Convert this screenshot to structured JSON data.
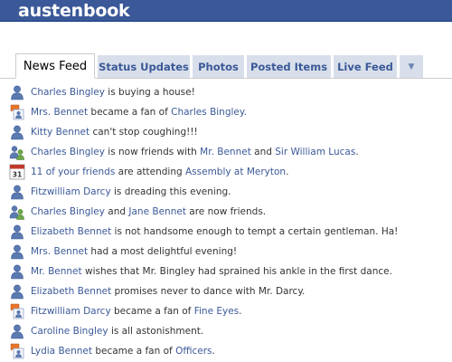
{
  "header": {
    "logo": "austenbook"
  },
  "tabs": [
    {
      "label": "News Feed",
      "active": true
    },
    {
      "label": "Status Updates"
    },
    {
      "label": "Photos"
    },
    {
      "label": "Posted Items"
    },
    {
      "label": "Live Feed"
    },
    {
      "label": "▼"
    }
  ],
  "feed": [
    {
      "icon": "person-icon",
      "parts": [
        {
          "t": "Charles Bingley",
          "link": true
        },
        {
          "t": " is buying a house!"
        }
      ]
    },
    {
      "icon": "fan-page-icon",
      "parts": [
        {
          "t": "Mrs. Bennet",
          "link": true
        },
        {
          "t": " became a fan of "
        },
        {
          "t": "Charles Bingley.",
          "link": true
        }
      ]
    },
    {
      "icon": "person-icon",
      "parts": [
        {
          "t": "Kitty Bennet",
          "link": true
        },
        {
          "t": " can't stop coughing!!!"
        }
      ]
    },
    {
      "icon": "friends-icon",
      "parts": [
        {
          "t": "Charles Bingley",
          "link": true
        },
        {
          "t": " is now friends with "
        },
        {
          "t": "Mr. Bennet",
          "link": true
        },
        {
          "t": " and "
        },
        {
          "t": "Sir William Lucas",
          "link": true
        },
        {
          "t": "."
        }
      ]
    },
    {
      "icon": "calendar-icon",
      "calendar_day": "31",
      "parts": [
        {
          "t": "11 of your friends",
          "link": true
        },
        {
          "t": " are attending "
        },
        {
          "t": "Assembly at Meryton",
          "link": true
        },
        {
          "t": "."
        }
      ]
    },
    {
      "icon": "person-icon",
      "parts": [
        {
          "t": "Fitzwilliam Darcy",
          "link": true
        },
        {
          "t": " is dreading this evening."
        }
      ]
    },
    {
      "icon": "friends-icon",
      "parts": [
        {
          "t": "Charles Bingley",
          "link": true
        },
        {
          "t": " and "
        },
        {
          "t": "Jane Bennet",
          "link": true
        },
        {
          "t": " are now friends."
        }
      ]
    },
    {
      "icon": "person-icon",
      "parts": [
        {
          "t": "Elizabeth Bennet",
          "link": true
        },
        {
          "t": " is not handsome enough to tempt a certain gentleman. Ha!"
        }
      ]
    },
    {
      "icon": "person-icon",
      "parts": [
        {
          "t": "Mrs. Bennet",
          "link": true
        },
        {
          "t": " had a most delightful evening!"
        }
      ]
    },
    {
      "icon": "person-icon",
      "parts": [
        {
          "t": "Mr. Bennet",
          "link": true
        },
        {
          "t": " wishes that Mr. Bingley had sprained his ankle in the first dance."
        }
      ]
    },
    {
      "icon": "person-icon",
      "parts": [
        {
          "t": "Elizabeth Bennet",
          "link": true
        },
        {
          "t": " promises never to dance with Mr. Darcy."
        }
      ]
    },
    {
      "icon": "fan-page-icon",
      "parts": [
        {
          "t": "Fitzwilliam Darcy",
          "link": true
        },
        {
          "t": " became a fan of "
        },
        {
          "t": "Fine Eyes",
          "link": true
        },
        {
          "t": "."
        }
      ]
    },
    {
      "icon": "person-icon",
      "parts": [
        {
          "t": "Caroline Bingley",
          "link": true
        },
        {
          "t": " is all astonishment."
        }
      ]
    },
    {
      "icon": "fan-page-icon",
      "parts": [
        {
          "t": "Lydia Bennet",
          "link": true
        },
        {
          "t": " became a fan of "
        },
        {
          "t": "Officers",
          "link": true
        },
        {
          "t": "."
        }
      ]
    }
  ],
  "colors": {
    "brand_blue": "#3b5998",
    "tab_bg": "#d8dfea",
    "link": "#3b5998",
    "text": "#333333"
  }
}
